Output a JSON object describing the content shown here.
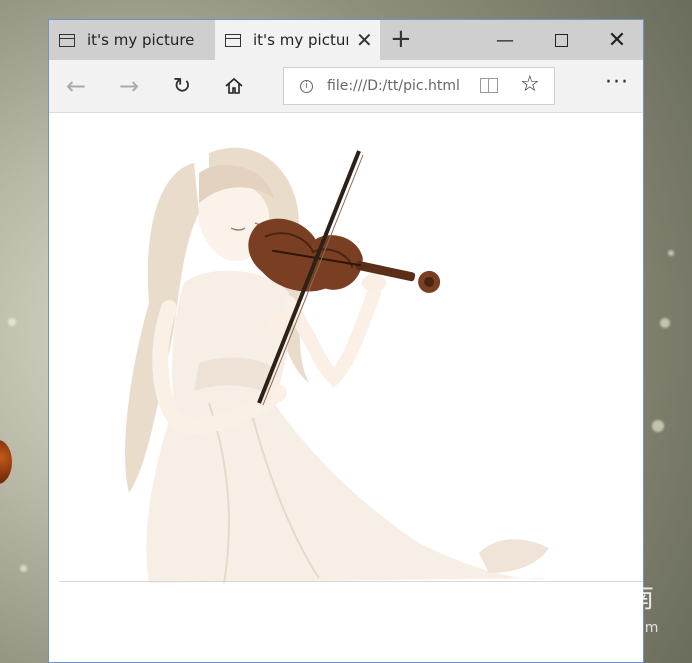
{
  "browser": {
    "tabs": [
      {
        "title": "it's my picture",
        "active": false
      },
      {
        "title": "it's my picture",
        "active": true
      }
    ],
    "new_tab_icon": "plus-icon",
    "window_controls": [
      "minimize-icon",
      "maximize-icon",
      "close-icon"
    ],
    "address": {
      "url": "file:///D:/tt/pic.html"
    },
    "more_label": "···"
  },
  "page": {
    "image_alt": "anime girl playing violin"
  },
  "watermark": {
    "brand": "搜狗指南",
    "domain": "zhinan.sogou.com"
  },
  "colors": {
    "tabbar_bg": "#cfcfcf",
    "active_tab_bg": "#f2f2f2",
    "window_border": "#6f93c9"
  }
}
